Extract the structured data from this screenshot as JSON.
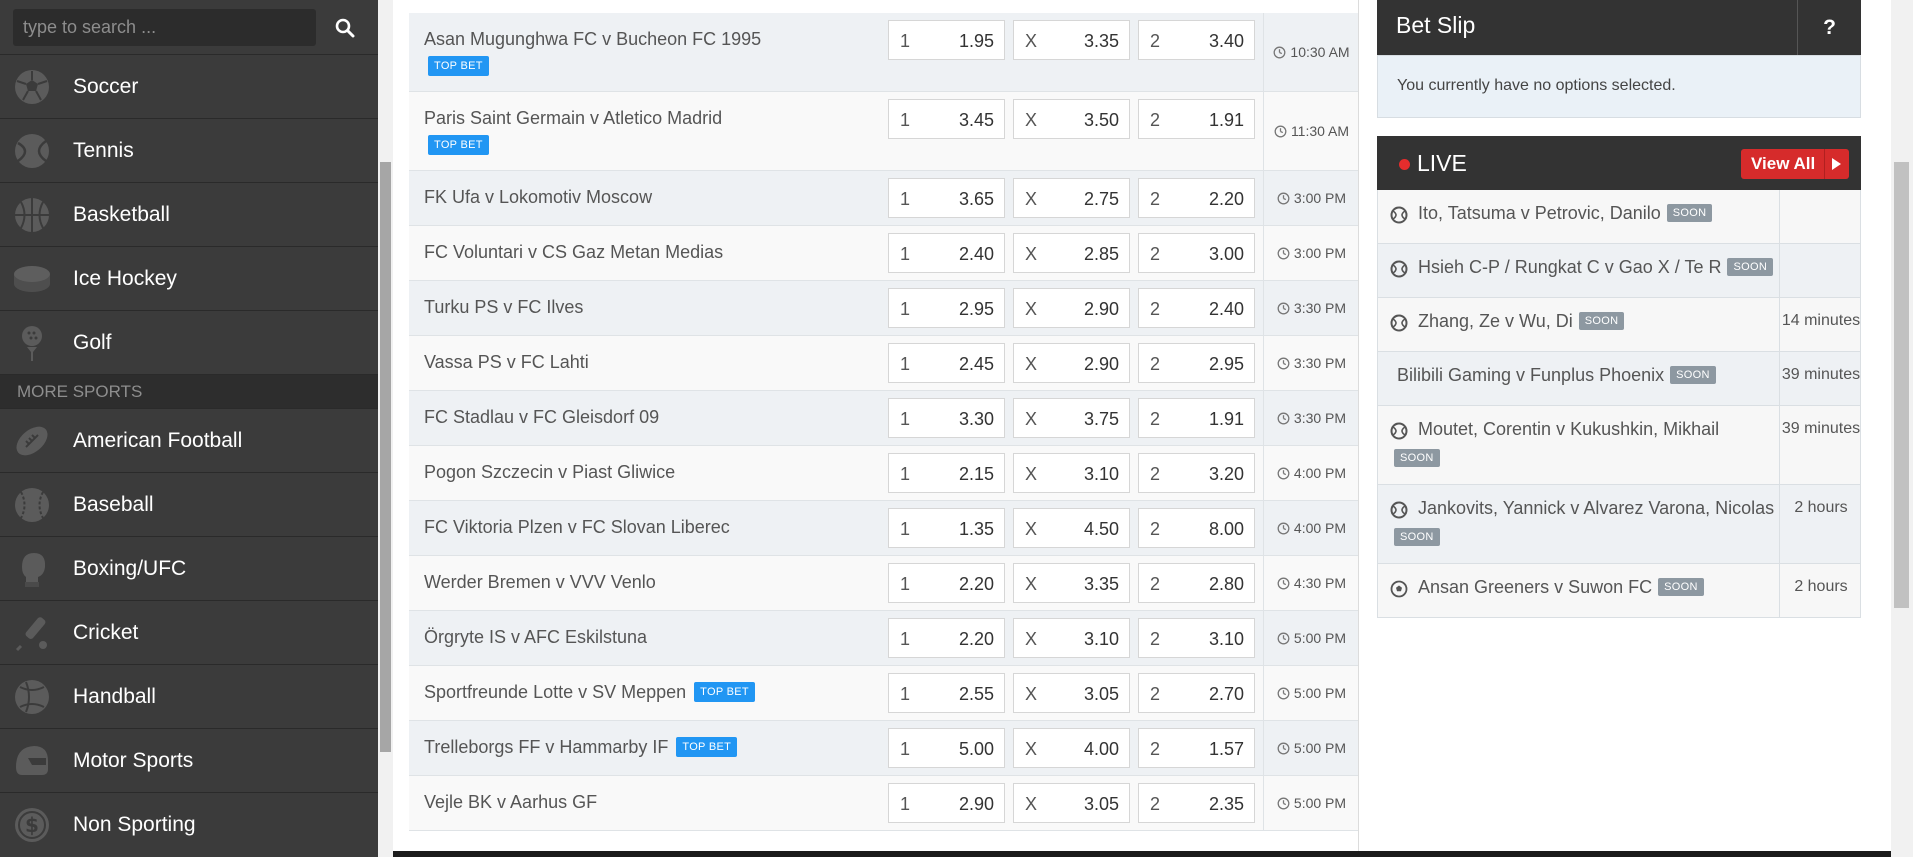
{
  "search": {
    "placeholder": "type to search ..."
  },
  "sidebar": {
    "top_sports": [
      {
        "label": "Soccer",
        "icon": "soccer-ball-icon"
      },
      {
        "label": "Tennis",
        "icon": "tennis-ball-icon"
      },
      {
        "label": "Basketball",
        "icon": "basketball-icon"
      },
      {
        "label": "Ice Hockey",
        "icon": "hockey-puck-icon"
      },
      {
        "label": "Golf",
        "icon": "golf-ball-icon"
      }
    ],
    "more_sports_label": "MORE SPORTS",
    "more_sports": [
      {
        "label": "American Football",
        "icon": "american-football-icon"
      },
      {
        "label": "Baseball",
        "icon": "baseball-icon"
      },
      {
        "label": "Boxing/UFC",
        "icon": "boxing-glove-icon"
      },
      {
        "label": "Cricket",
        "icon": "cricket-bat-icon"
      },
      {
        "label": "Handball",
        "icon": "handball-icon"
      },
      {
        "label": "Motor Sports",
        "icon": "racing-helmet-icon"
      },
      {
        "label": "Non Sporting",
        "icon": "dollar-coin-icon"
      }
    ]
  },
  "matches": [
    {
      "name": "Asan Mugunghwa FC v Bucheon FC 1995",
      "badge": "TOP BET",
      "badge_pos": "below",
      "home_label": "1",
      "home": "1.95",
      "draw_label": "X",
      "draw": "3.35",
      "away_label": "2",
      "away": "3.40",
      "time": "10:30 AM"
    },
    {
      "name": "Paris Saint Germain v Atletico Madrid",
      "badge": "TOP BET",
      "badge_pos": "below",
      "home_label": "1",
      "home": "3.45",
      "draw_label": "X",
      "draw": "3.50",
      "away_label": "2",
      "away": "1.91",
      "time": "11:30 AM"
    },
    {
      "name": "FK Ufa v Lokomotiv Moscow",
      "badge": "",
      "badge_pos": "",
      "home_label": "1",
      "home": "3.65",
      "draw_label": "X",
      "draw": "2.75",
      "away_label": "2",
      "away": "2.20",
      "time": "3:00 PM"
    },
    {
      "name": "FC Voluntari v CS Gaz Metan Medias",
      "badge": "",
      "badge_pos": "",
      "home_label": "1",
      "home": "2.40",
      "draw_label": "X",
      "draw": "2.85",
      "away_label": "2",
      "away": "3.00",
      "time": "3:00 PM"
    },
    {
      "name": "Turku PS v FC Ilves",
      "badge": "",
      "badge_pos": "",
      "home_label": "1",
      "home": "2.95",
      "draw_label": "X",
      "draw": "2.90",
      "away_label": "2",
      "away": "2.40",
      "time": "3:30 PM"
    },
    {
      "name": "Vassa PS v FC Lahti",
      "badge": "",
      "badge_pos": "",
      "home_label": "1",
      "home": "2.45",
      "draw_label": "X",
      "draw": "2.90",
      "away_label": "2",
      "away": "2.95",
      "time": "3:30 PM"
    },
    {
      "name": "FC Stadlau v FC Gleisdorf 09",
      "badge": "",
      "badge_pos": "",
      "home_label": "1",
      "home": "3.30",
      "draw_label": "X",
      "draw": "3.75",
      "away_label": "2",
      "away": "1.91",
      "time": "3:30 PM"
    },
    {
      "name": "Pogon Szczecin v Piast Gliwice",
      "badge": "",
      "badge_pos": "",
      "home_label": "1",
      "home": "2.15",
      "draw_label": "X",
      "draw": "3.10",
      "away_label": "2",
      "away": "3.20",
      "time": "4:00 PM"
    },
    {
      "name": "FC Viktoria Plzen v FC Slovan Liberec",
      "badge": "",
      "badge_pos": "",
      "home_label": "1",
      "home": "1.35",
      "draw_label": "X",
      "draw": "4.50",
      "away_label": "2",
      "away": "8.00",
      "time": "4:00 PM"
    },
    {
      "name": "Werder Bremen v VVV Venlo",
      "badge": "",
      "badge_pos": "",
      "home_label": "1",
      "home": "2.20",
      "draw_label": "X",
      "draw": "3.35",
      "away_label": "2",
      "away": "2.80",
      "time": "4:30 PM"
    },
    {
      "name": "Örgryte IS v AFC Eskilstuna",
      "badge": "",
      "badge_pos": "",
      "home_label": "1",
      "home": "2.20",
      "draw_label": "X",
      "draw": "3.10",
      "away_label": "2",
      "away": "3.10",
      "time": "5:00 PM"
    },
    {
      "name": "Sportfreunde Lotte v SV Meppen",
      "badge": "TOP BET",
      "badge_pos": "inline",
      "home_label": "1",
      "home": "2.55",
      "draw_label": "X",
      "draw": "3.05",
      "away_label": "2",
      "away": "2.70",
      "time": "5:00 PM"
    },
    {
      "name": "Trelleborgs FF v Hammarby IF",
      "badge": "TOP BET",
      "badge_pos": "inline",
      "home_label": "1",
      "home": "5.00",
      "draw_label": "X",
      "draw": "4.00",
      "away_label": "2",
      "away": "1.57",
      "time": "5:00 PM"
    },
    {
      "name": "Vejle BK v Aarhus GF",
      "badge": "",
      "badge_pos": "",
      "home_label": "1",
      "home": "2.90",
      "draw_label": "X",
      "draw": "3.05",
      "away_label": "2",
      "away": "2.35",
      "time": "5:00 PM"
    }
  ],
  "betslip": {
    "title": "Bet Slip",
    "help": "?",
    "empty_message": "You currently have no options selected."
  },
  "live": {
    "title": "LIVE",
    "view_all": "View All",
    "items": [
      {
        "name": "Ito, Tatsuma v Petrovic, Danilo",
        "badge": "SOON",
        "badge_pos": "inline",
        "icon": "tennis-icon",
        "time": ""
      },
      {
        "name": "Hsieh C-P / Rungkat C v Gao X / Te R",
        "badge": "SOON",
        "badge_pos": "inline",
        "icon": "tennis-icon",
        "time": ""
      },
      {
        "name": "Zhang, Ze v Wu, Di",
        "badge": "SOON",
        "badge_pos": "inline",
        "icon": "tennis-icon",
        "time": "14 minutes"
      },
      {
        "name": "Bilibili Gaming v Funplus Phoenix",
        "badge": "SOON",
        "badge_pos": "inline",
        "icon": "",
        "time": "39 minutes"
      },
      {
        "name": "Moutet, Corentin v Kukushkin, Mikhail",
        "badge": "SOON",
        "badge_pos": "below",
        "icon": "tennis-icon",
        "time": "39 minutes"
      },
      {
        "name": "Jankovits, Yannick v Alvarez Varona, Nicolas",
        "badge": "SOON",
        "badge_pos": "below",
        "icon": "tennis-icon",
        "time": "2 hours"
      },
      {
        "name": "Ansan Greeners v Suwon FC",
        "badge": "SOON",
        "badge_pos": "inline",
        "icon": "soccer-icon",
        "time": "2 hours"
      }
    ]
  },
  "colors": {
    "sidebar_bg": "#3b3b3b",
    "header_bg": "#333333",
    "top_bet_badge": "#2196f3",
    "soon_badge": "#8d98a1",
    "live_dot": "#e52d2d",
    "view_all_button": "#d62b2b"
  }
}
